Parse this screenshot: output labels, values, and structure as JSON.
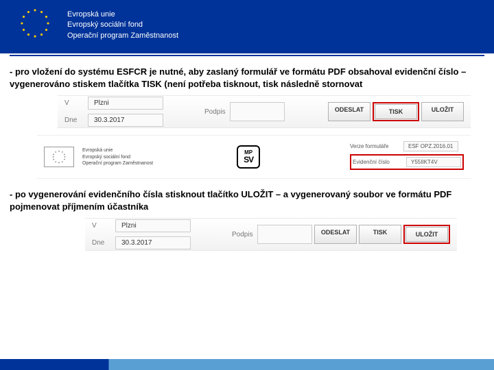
{
  "header": {
    "line1": "Evropská unie",
    "line2": "Evropský sociální fond",
    "line3": "Operační program Zaměstnanost"
  },
  "para1": "- pro vložení do systému ESFCR je nutné, aby zaslaný formulář ve formátu PDF obsahoval evidenční číslo – vygenerováno stiskem tlačítka TISK (není potřeba tisknout, tisk následně stornovat",
  "fig1": {
    "v_label": "V",
    "v_value": "Plzni",
    "dne_label": "Dne",
    "dne_value": "30.3.2017",
    "podpis_label": "Podpis",
    "btn_odeslat": "ODESLAT",
    "btn_tisk": "TISK",
    "btn_ulozit": "ULOŽIT",
    "highlight": "tisk"
  },
  "fig2": {
    "mini_line1": "Evropská unie",
    "mini_line2": "Evropský sociální fond",
    "mini_line3": "Operační program Zaměstnanost",
    "mpsv_top": "MP",
    "mpsv_bot": "SV",
    "verze_label": "Verze formuláře",
    "verze_value": "ESF OPZ.2016.01",
    "evid_label": "Evidenční číslo",
    "evid_value": "Y55IIKT4V"
  },
  "para2": "- po vygenerování evidenčního čísla stisknout tlačítko ULOŽIT – a vygenerovaný soubor ve formátu PDF pojmenovat příjmením účastníka",
  "fig3": {
    "v_label": "V",
    "v_value": "Plzni",
    "dne_label": "Dne",
    "dne_value": "30.3.2017",
    "podpis_label": "Podpis",
    "btn_odeslat": "ODESLAT",
    "btn_tisk": "TISK",
    "btn_ulozit": "ULOŽIT",
    "highlight": "ulozit"
  }
}
